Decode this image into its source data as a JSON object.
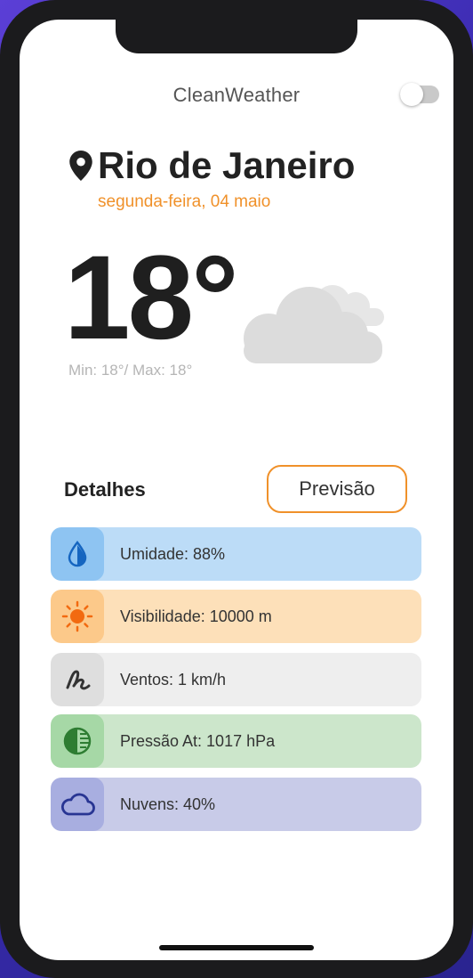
{
  "app": {
    "title": "CleanWeather",
    "dark_mode_toggle": false
  },
  "location": {
    "city": "Rio de Janeiro",
    "date": "segunda-feira, 04 maio"
  },
  "current": {
    "temperature": "18°",
    "minmax": "Min: 18°/ Max: 18°",
    "condition_icon": "cloud-icon"
  },
  "details": {
    "title": "Detalhes",
    "forecast_button": "Previsão",
    "items": [
      {
        "label": "Umidade: 88%",
        "icon": "water-drop-icon",
        "color": "#bcdcf7"
      },
      {
        "label": "Visibilidade: 10000 m",
        "icon": "sun-icon",
        "color": "#fde0b9"
      },
      {
        "label": "Ventos: 1 km/h",
        "icon": "wind-icon",
        "color": "#eeeeee"
      },
      {
        "label": "Pressão At: 1017 hPa",
        "icon": "pressure-icon",
        "color": "#cce6cb"
      },
      {
        "label": "Nuvens: 40%",
        "icon": "cloud-icon",
        "color": "#c8cbe8"
      }
    ]
  },
  "colors": {
    "accent": "#f0912a",
    "text": "#222222"
  }
}
